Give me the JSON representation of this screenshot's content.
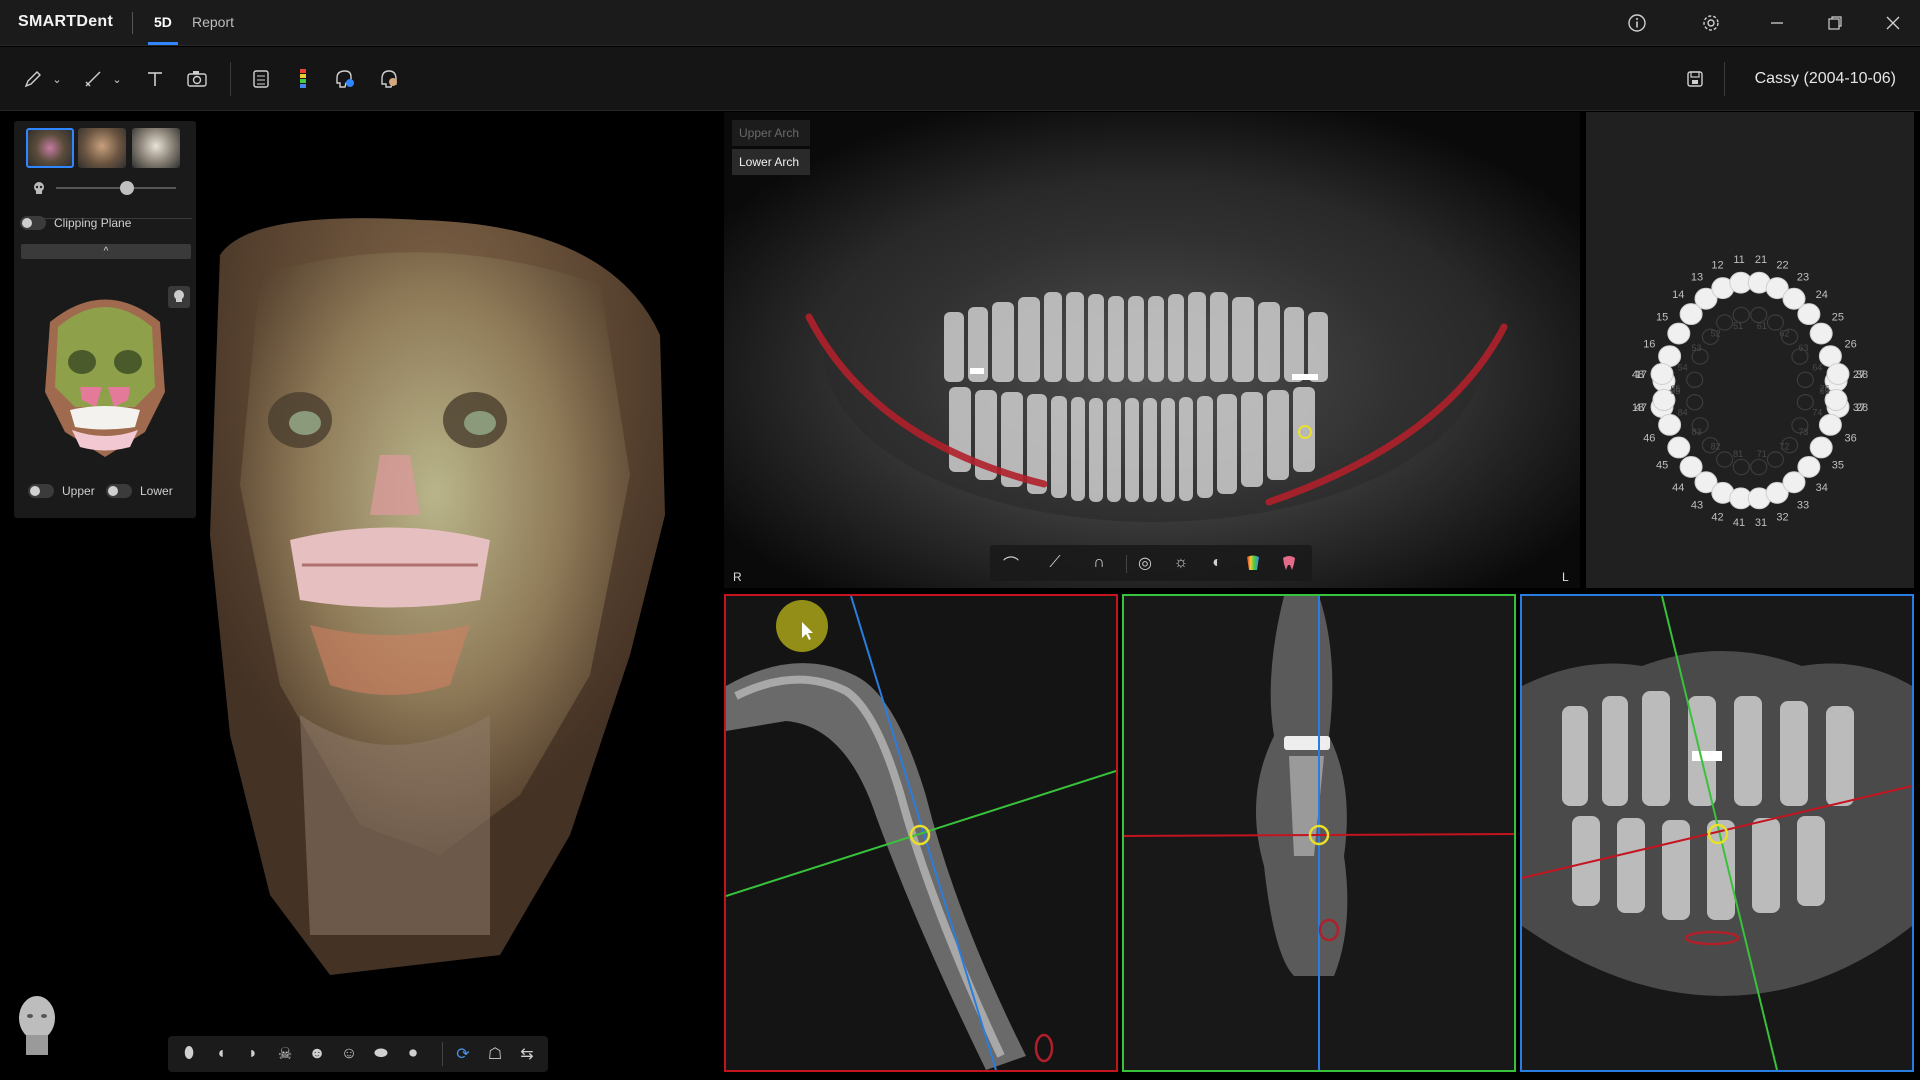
{
  "app": {
    "logo": "SMARTDent"
  },
  "tabs": [
    {
      "label": "5D",
      "active": true
    },
    {
      "label": "Report",
      "active": false
    }
  ],
  "window_controls": [
    "info-icon",
    "settings-icon",
    "minimize-icon",
    "restore-icon",
    "close-icon"
  ],
  "toolbar": {
    "tools": [
      "draw-pen-icon",
      "dropdown-icon",
      "measure-line-icon",
      "dropdown-icon",
      "text-icon",
      "camera-icon",
      "panorama-icon",
      "color-bar-icon",
      "tooth-segment-icon",
      "face-scan-icon"
    ],
    "save_icon": "save-icon",
    "patient": "Cassy (2004-10-06)"
  },
  "left_panel": {
    "clipping_plane_label": "Clipping Plane",
    "collapse_glyph": "^",
    "upper_label": "Upper",
    "lower_label": "Lower"
  },
  "pano": {
    "upper_arch": "Upper Arch",
    "lower_arch": "Lower Arch",
    "right_marker": "R",
    "left_marker": "L"
  },
  "tooth_chart": {
    "upper_permanent": [
      "18",
      "17",
      "16",
      "15",
      "14",
      "13",
      "12",
      "11",
      "21",
      "22",
      "23",
      "24",
      "25",
      "26",
      "27",
      "28"
    ],
    "lower_permanent": [
      "48",
      "47",
      "46",
      "45",
      "44",
      "43",
      "42",
      "41",
      "31",
      "32",
      "33",
      "34",
      "35",
      "36",
      "37",
      "38"
    ],
    "upper_primary": [
      "55",
      "54",
      "53",
      "52",
      "51",
      "61",
      "62",
      "63",
      "64",
      "65"
    ],
    "lower_primary": [
      "85",
      "84",
      "83",
      "82",
      "81",
      "71",
      "72",
      "73",
      "74",
      "75"
    ]
  },
  "colors": {
    "accent": "#2f86ff",
    "axial_border": "#c4141f",
    "cross_border": "#38c23c",
    "tangent_border": "#2a7de0",
    "nerve_canal": "#b0202a",
    "crosshair": "#e8e02a"
  }
}
